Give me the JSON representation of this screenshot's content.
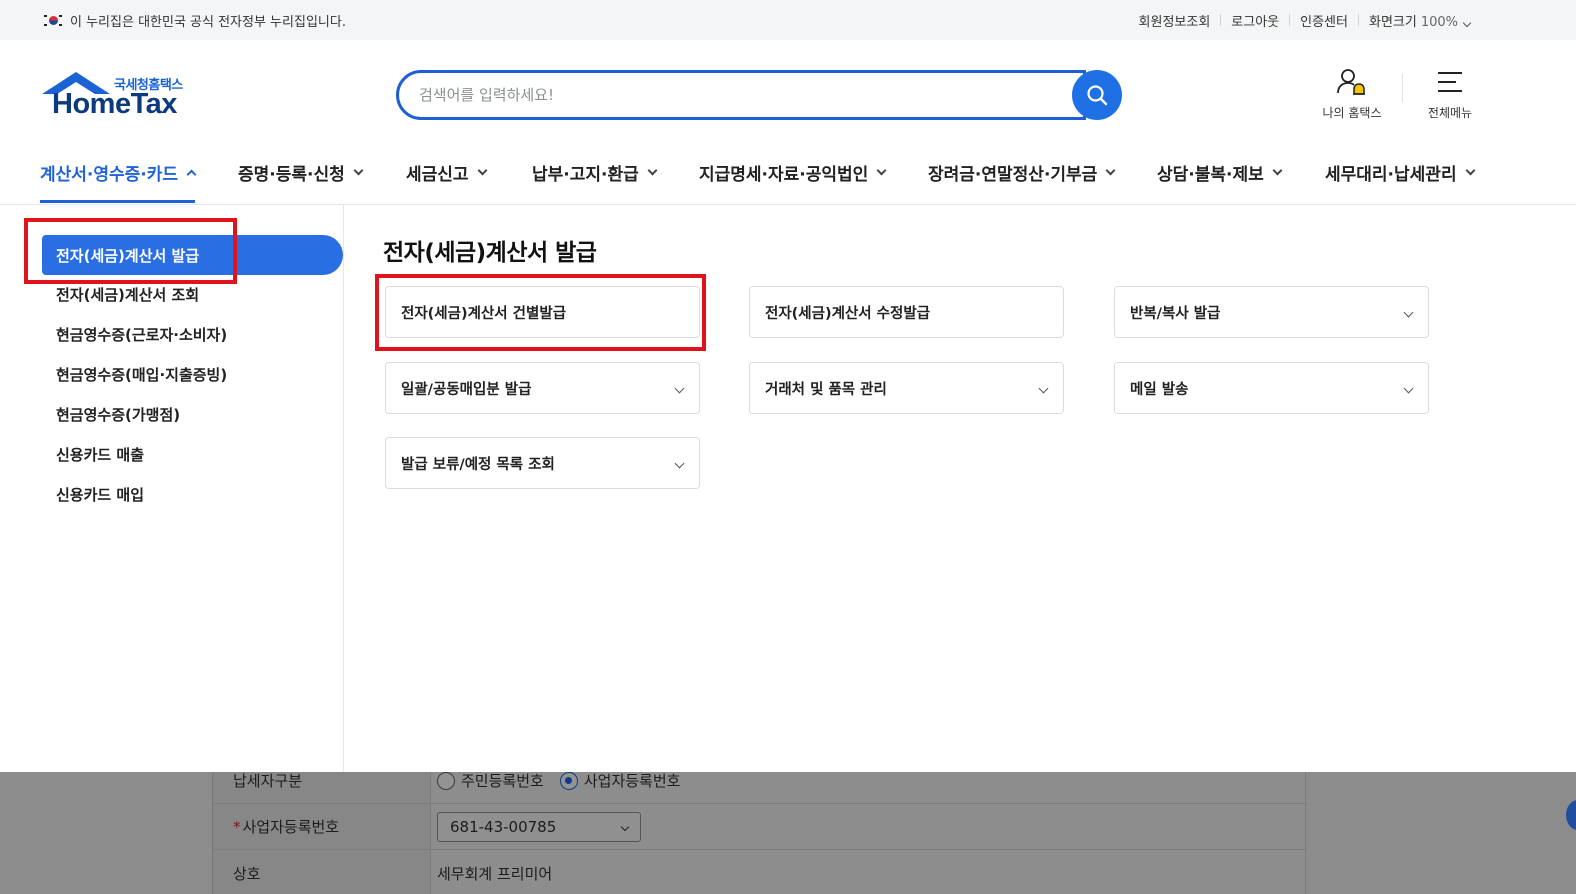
{
  "gov_banner": {
    "text": "이 누리집은 대한민국 공식 전자정부 누리집입니다.",
    "links": [
      "회원정보조회",
      "로그아웃",
      "인증센터"
    ],
    "zoom_label": "화면크기",
    "zoom_value": "100%"
  },
  "logo": {
    "sub": "국세청홈택스",
    "main": "HomeTax"
  },
  "search": {
    "placeholder": "검색어를 입력하세요!"
  },
  "header_buttons": {
    "my_hometax": "나의 홈택스",
    "all_menu": "전체메뉴"
  },
  "nav": [
    "계산서·영수증·카드",
    "증명·등록·신청",
    "세금신고",
    "납부·고지·환급",
    "지급명세·자료·공익법인",
    "장려금·연말정산·기부금",
    "상담·불복·제보",
    "세무대리·납세관리"
  ],
  "sidebar": {
    "active": "전자(세금)계산서 발급",
    "items": [
      "전자(세금)계산서 조회",
      "현금영수증(근로자·소비자)",
      "현금영수증(매입·지출증빙)",
      "현금영수증(가맹점)",
      "신용카드 매출",
      "신용카드 매입"
    ]
  },
  "main": {
    "title": "전자(세금)계산서 발급",
    "cards": [
      "전자(세금)계산서 건별발급",
      "전자(세금)계산서 수정발급",
      "반복/복사 발급",
      "일괄/공동매입분 발급",
      "거래처 및 품목 관리",
      "메일 발송",
      "발급 보류/예정 목록 조회"
    ]
  },
  "background_form": {
    "taxpayer_type_label": "납세자구분",
    "radio_resident": "주민등록번호",
    "radio_business": "사업자등록번호",
    "required_mark": "*",
    "business_no_label": "사업자등록번호",
    "business_no_value": "681-43-00785",
    "company_label": "상호",
    "company_value": "세무회계 프리미어"
  },
  "colors": {
    "brand_blue": "#1f63d9",
    "highlight_red": "#e0121c"
  }
}
